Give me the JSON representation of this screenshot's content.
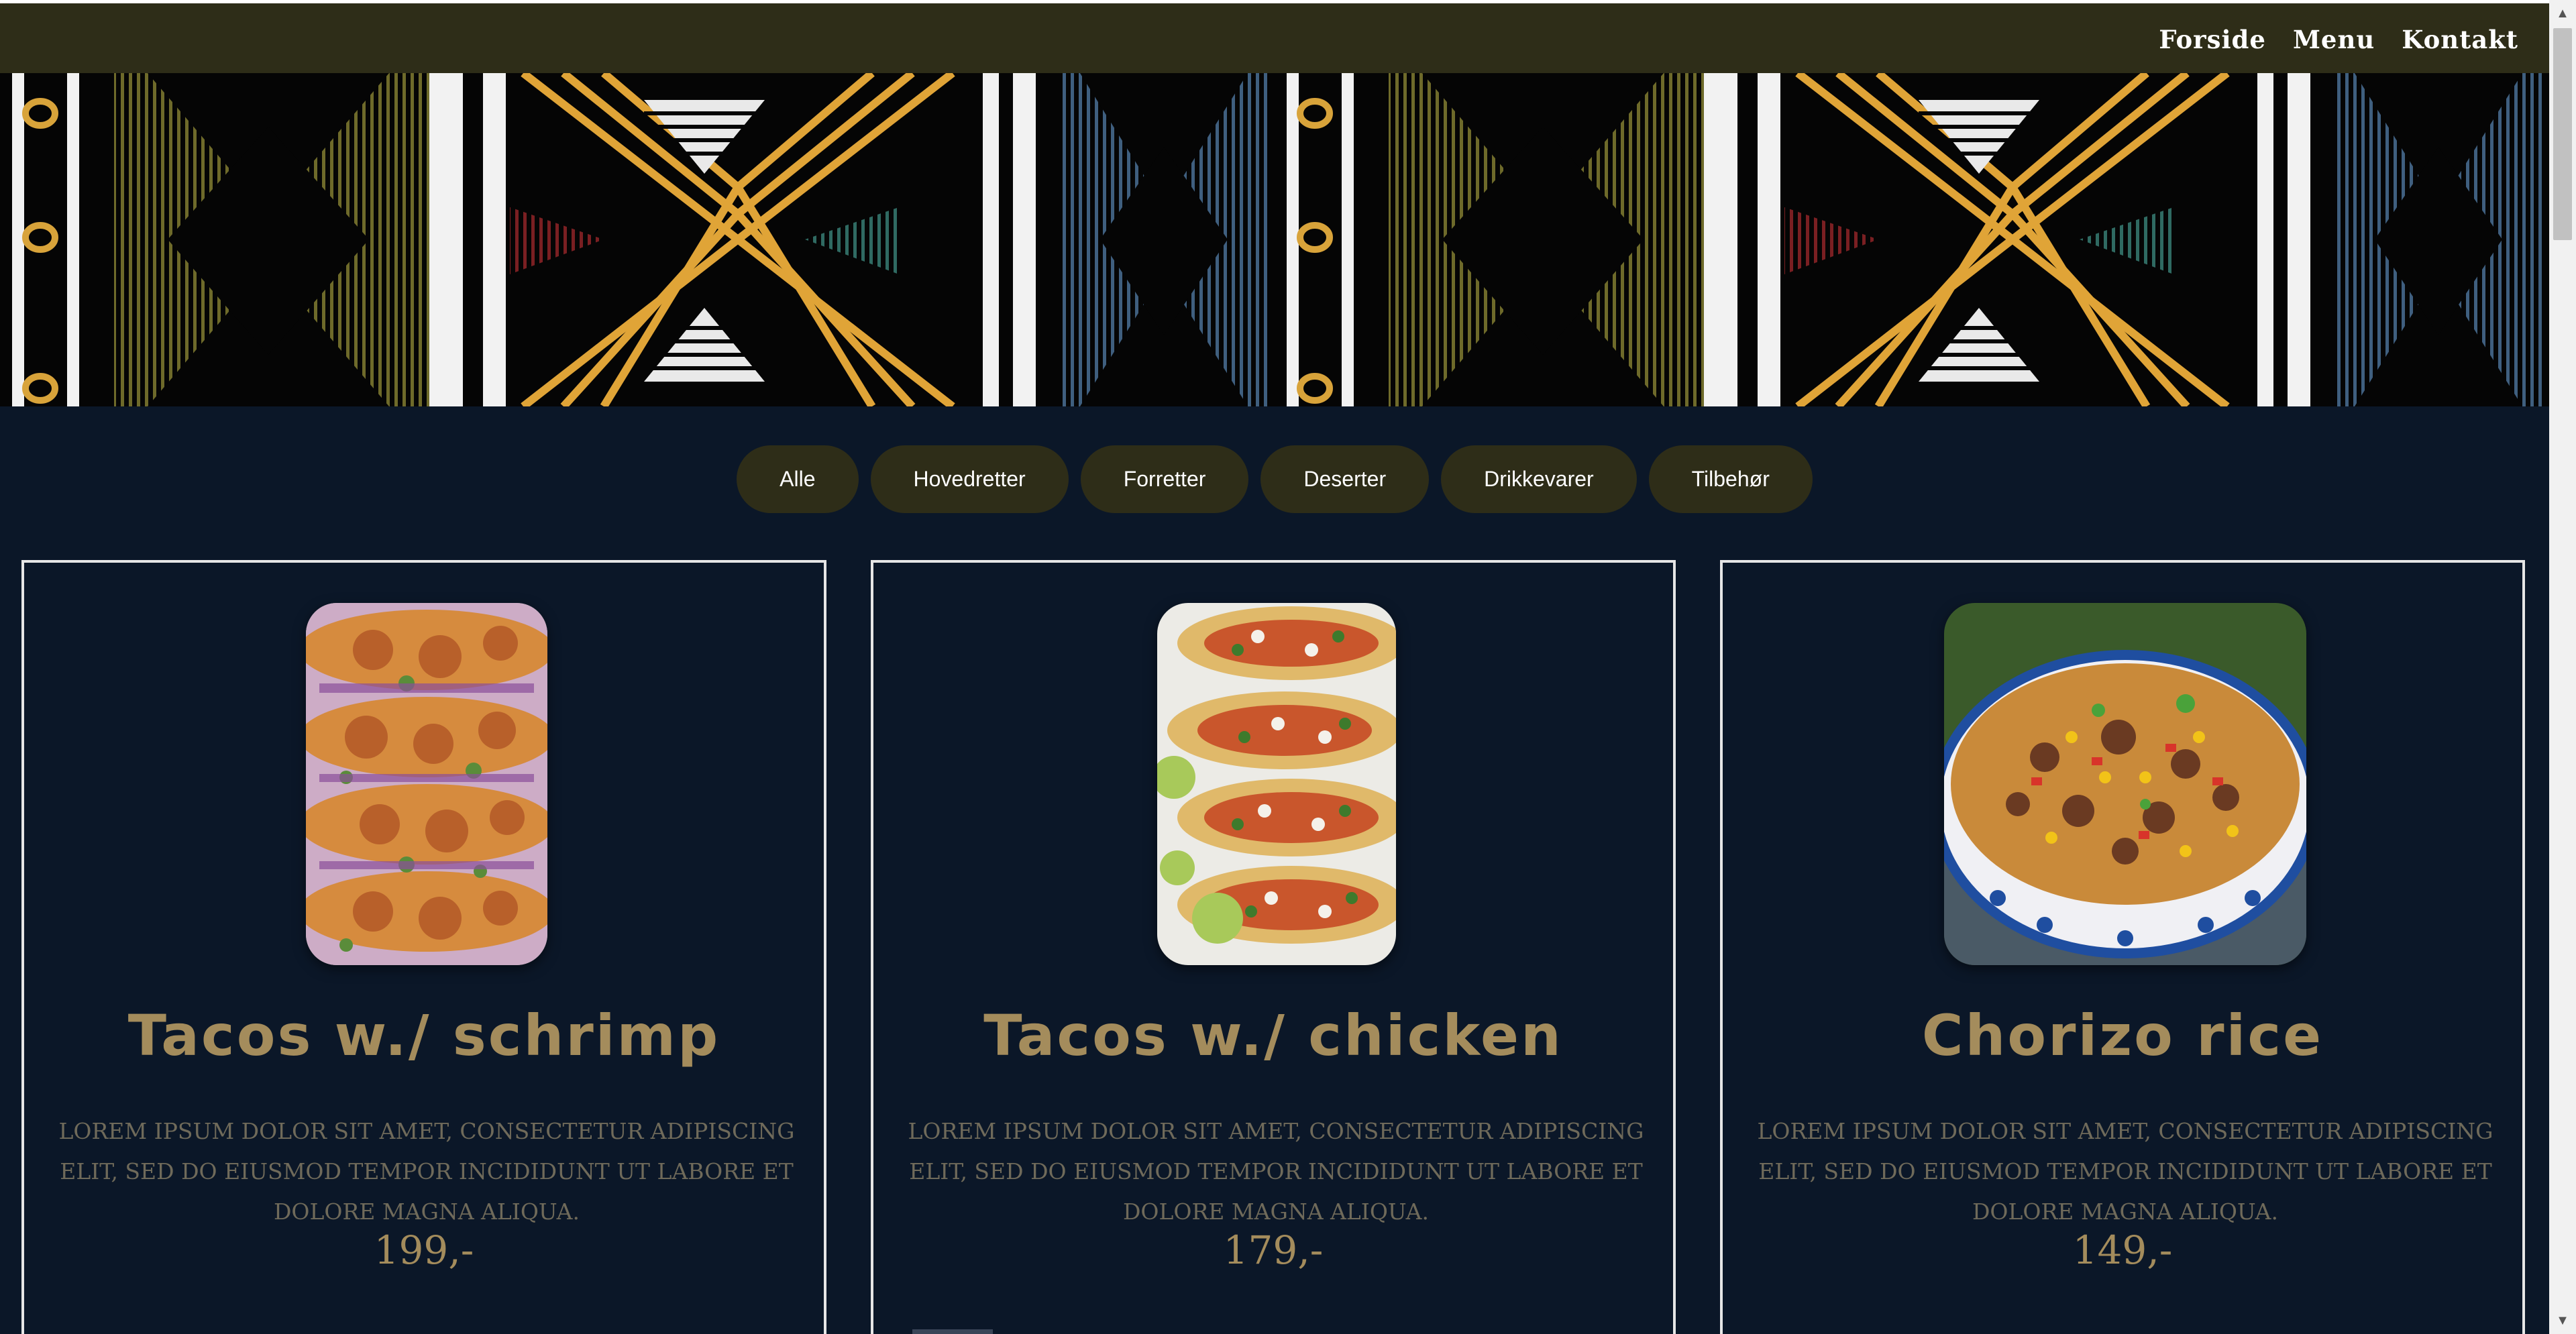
{
  "nav": {
    "links": [
      "Forside",
      "Menu",
      "Kontakt"
    ]
  },
  "filters": [
    "Alle",
    "Hovedretter",
    "Forretter",
    "Deserter",
    "Drikkevarer",
    "Tilbehør"
  ],
  "menu_items": [
    {
      "title": "Tacos w./ schrimp",
      "description": "Lorem ipsum dolor sit amet, consectetur adipiscing elit, sed do eiusmod tempor incididunt ut labore et dolore magna aliqua.",
      "price": "199,-",
      "image": "shrimp-tacos-photo"
    },
    {
      "title": "Tacos w./ chicken",
      "description": "Lorem ipsum dolor sit amet, consectetur adipiscing elit, sed do eiusmod tempor incididunt ut labore et dolore magna aliqua.",
      "price": "179,-",
      "image": "chicken-tacos-photo"
    },
    {
      "title": "Chorizo rice",
      "description": "Lorem ipsum dolor sit amet, consectetur adipiscing elit, sed do eiusmod tempor incididunt ut labore et dolore magna aliqua.",
      "price": "149,-",
      "image": "chorizo-rice-photo"
    }
  ],
  "colors": {
    "navbar": "#2e2d18",
    "page_background": "#0b1728",
    "accent_gold": "#a48c5c",
    "button_bg": "#2e2d18"
  }
}
